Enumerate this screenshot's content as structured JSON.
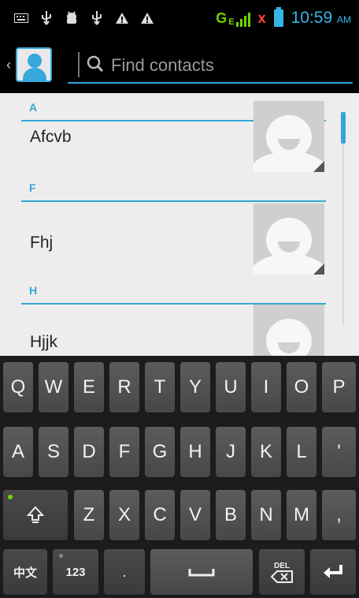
{
  "status_bar": {
    "network": "G",
    "network_superscript": "E",
    "sim_status": "x",
    "time": "10:59",
    "ampm": "AM"
  },
  "action_bar": {
    "search_placeholder": "Find contacts"
  },
  "contacts": [
    {
      "section": "A",
      "name": "Afcvb"
    },
    {
      "section": "F",
      "name": "Fhj"
    },
    {
      "section": "H",
      "name": "Hjjk"
    }
  ],
  "keyboard": {
    "row1": [
      "Q",
      "W",
      "E",
      "R",
      "T",
      "Y",
      "U",
      "I",
      "O",
      "P"
    ],
    "row2": [
      "A",
      "S",
      "D",
      "F",
      "G",
      "H",
      "J",
      "K",
      "L",
      "'"
    ],
    "row3": [
      "Z",
      "X",
      "C",
      "V",
      "B",
      "N",
      "M",
      ","
    ],
    "bottom": {
      "lang": "中文",
      "numbers": "123",
      "period": ".",
      "del": "DEL"
    }
  },
  "colors": {
    "accent": "#33a6d6",
    "network": "#6dd400",
    "sim_error": "#ff4a3a"
  }
}
